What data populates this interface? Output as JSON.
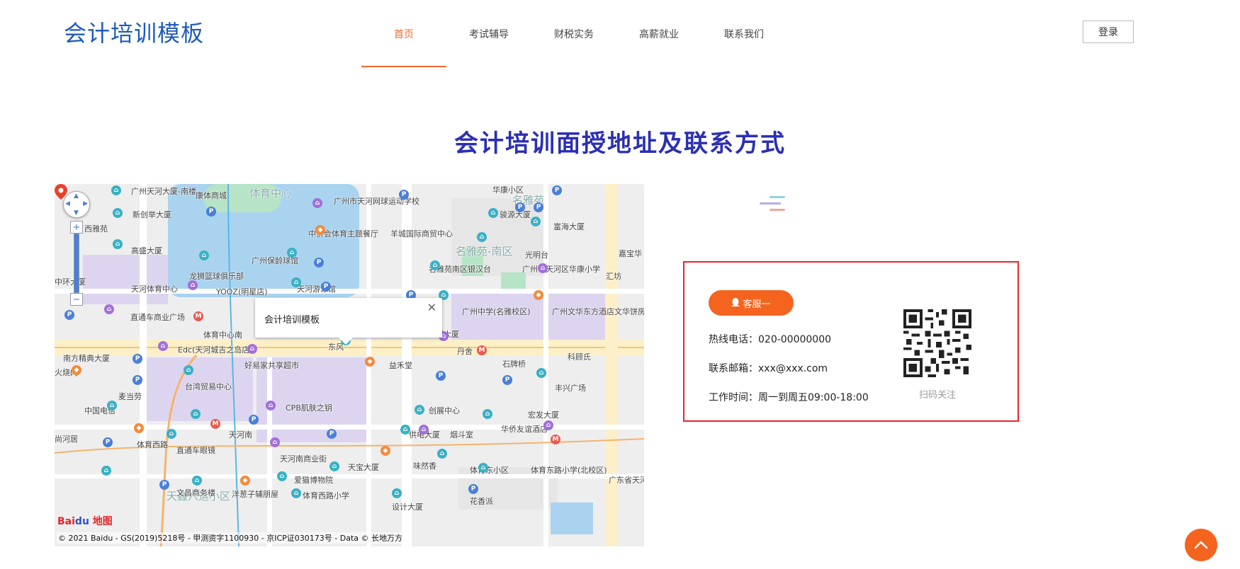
{
  "header": {
    "logo_text": "会计培训模板",
    "nav": [
      {
        "label": "首页",
        "active": true
      },
      {
        "label": "考试辅导"
      },
      {
        "label": "财税实务"
      },
      {
        "label": "高薪就业"
      },
      {
        "label": "联系我们"
      }
    ],
    "login_label": "登录"
  },
  "section": {
    "title": "会计培训面授地址及联系方式"
  },
  "map": {
    "info_window_title": "会计培训模板",
    "logo": "Bai",
    "logo_tail": "地图",
    "copyright": "© 2021 Baidu - GS(2019)5218号 - 甲测资字1100930 - 京ICP证030173号 - Data © 长地万方",
    "area_labels": [
      "体育中心",
      "名雅苑",
      "名雅苑-南区",
      "天鑫六运小区"
    ],
    "poi_labels": [
      "广州天河大厦-南楼",
      "康体商城",
      "广州市天河网球运动学校",
      "华康小区",
      "西雅苑",
      "新创举大厦",
      "骏源大厦",
      "富海大厦",
      "嘉宝华",
      "中侨会体育主题餐厅",
      "羊城国际商贸中心",
      "高盛大厦",
      "广州保龄球馆",
      "光明台",
      "名雅苑南区银汉台",
      "广州市天河区华康小学",
      "汇坊",
      "龙狮篮球俱乐部",
      "中环大厦",
      "天河体育中心",
      "YOOZ(明星店)",
      "天河游泳馆",
      "直通车商业广场",
      "广州中学(名雅校区)",
      "广州文华东方酒店文华饼房",
      "体育中心南",
      "广东外经贸大厦",
      "东风",
      "南方精典大厦",
      "Edc(天河城吉之岛店)",
      "丹舍",
      "石牌桥",
      "科顾氏",
      "好易家共享超市",
      "益禾堂",
      "火烧肉",
      "台湾贸易中心",
      "丰兴广场",
      "麦当劳",
      "中国电信",
      "CPB肌肤之钥",
      "创展中心",
      "宏发大厦",
      "华侨友谊酒店",
      "尚河居",
      "体育西路",
      "天河南",
      "供电大厦",
      "烟斗室",
      "直通车眼镜",
      "天河南商业街",
      "味然香",
      "天宝大厦",
      "体育东小区",
      "体育东路小学(北校区)",
      "广东省天河门",
      "爱猫博物院",
      "文昌商务楼",
      "洋葱子辅朋屋",
      "体育西路小学",
      "花香派",
      "设计大厦"
    ]
  },
  "contact": {
    "kefu_label": "客服一",
    "phone": "热线电话：020-00000000",
    "email": "联系邮箱：xxx@xxx.com",
    "hours": "工作时间：周一到周五09:00-18:00",
    "qr_caption": "扫码关注"
  },
  "colors": {
    "accent": "#f4641f",
    "nav_active": "#f06a31",
    "title": "#2b2fb3",
    "logo": "#1e5bb8",
    "box_border": "#e8262b"
  }
}
